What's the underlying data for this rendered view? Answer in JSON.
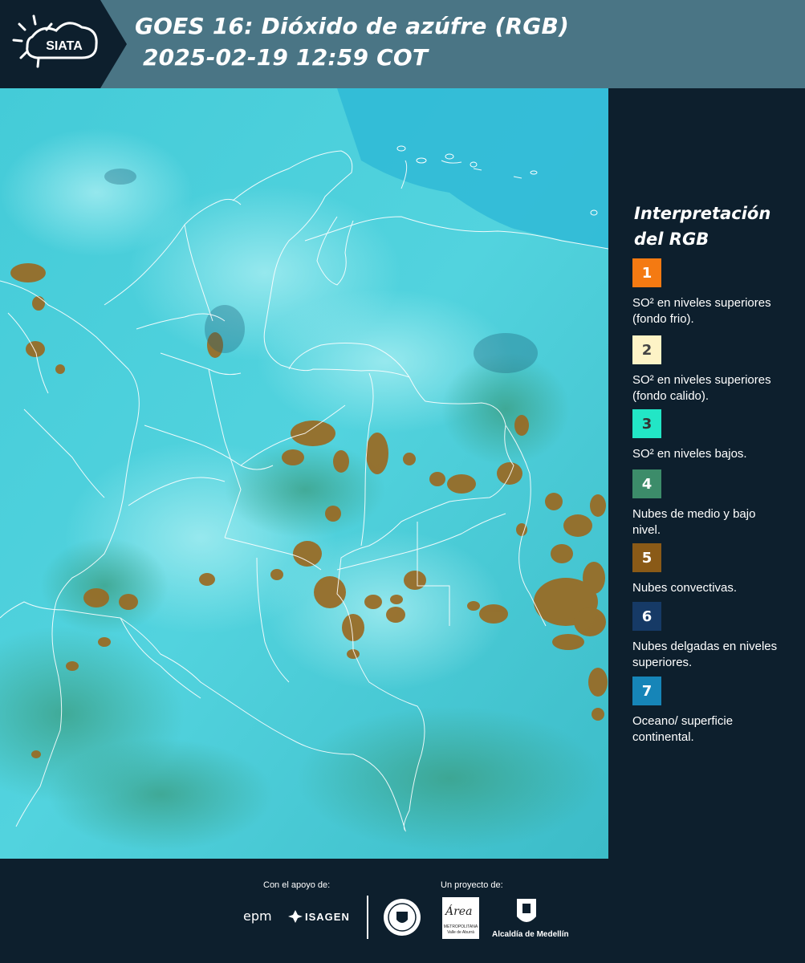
{
  "header": {
    "logo_text": "SIATA",
    "title_line1": "GOES 16: Dióxido de azúfre (RGB)",
    "title_line2": "2025-02-19 12:59 COT"
  },
  "legend": {
    "title": "Interpretación del RGB",
    "items": [
      {
        "number": "1",
        "color": "#f47a12",
        "text_color": "#ffffff",
        "text": "SO² en niveles superiores (fondo frio)."
      },
      {
        "number": "2",
        "color": "#fdf3c6",
        "text_color": "#444444",
        "text": "SO² en niveles superiores (fondo calido)."
      },
      {
        "number": "3",
        "color": "#22e6c6",
        "text_color": "#333333",
        "text": "SO² en niveles bajos."
      },
      {
        "number": "4",
        "color": "#3c8c6a",
        "text_color": "#ffffff",
        "text": "Nubes de medio y bajo nivel."
      },
      {
        "number": "5",
        "color": "#8a5a17",
        "text_color": "#ffffff",
        "text": "Nubes convectivas."
      },
      {
        "number": "6",
        "color": "#163a66",
        "text_color": "#ffffff",
        "text": "Nubes delgadas en niveles superiores."
      },
      {
        "number": "7",
        "color": "#1685b8",
        "text_color": "#ffffff",
        "text": "Oceano/ superficie continental."
      }
    ]
  },
  "footer": {
    "support_label": "Con el apoyo de:",
    "project_label": "Un proyecto de:",
    "sponsor1": "epm",
    "sponsor2": "ISAGEN",
    "partner_area": "Área",
    "partner_area_sub": "METROPOLITANA Valle de Aburrá",
    "partner_alcaldia": "Alcaldía de Medellín"
  },
  "map": {
    "background_color": "#3fc9d6",
    "cloud_color_convective": "#9a6a22",
    "cloud_color_low": "#3e9c8a",
    "border_color": "#ffffff"
  }
}
